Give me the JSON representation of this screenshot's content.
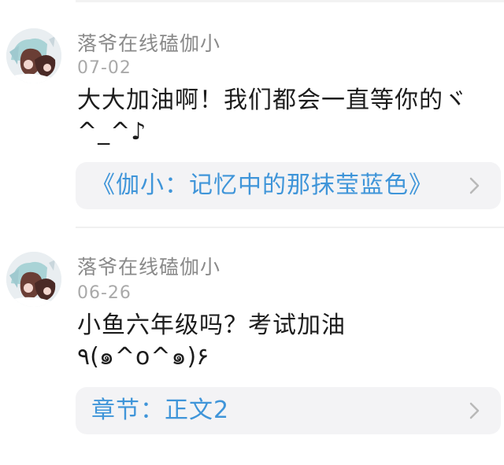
{
  "comments": [
    {
      "username": "落爷在线磕伽小",
      "date": "07-02",
      "text": "大大加油啊！我们都会一直等你的ヾ^_^♪",
      "chapter": "《伽小：记忆中的那抹莹蓝色》",
      "avatar_icon": "anime-avatar-icon"
    },
    {
      "username": "落爷在线磕伽小",
      "date": "06-26",
      "text": "小鱼六年级吗？考试加油٩(๑^o^๑)۶",
      "chapter": "章节：正文2",
      "avatar_icon": "anime-avatar-icon"
    }
  ],
  "colors": {
    "link": "#3f95d9",
    "card_bg": "#f3f3f5",
    "meta": "#a9a9a9"
  }
}
